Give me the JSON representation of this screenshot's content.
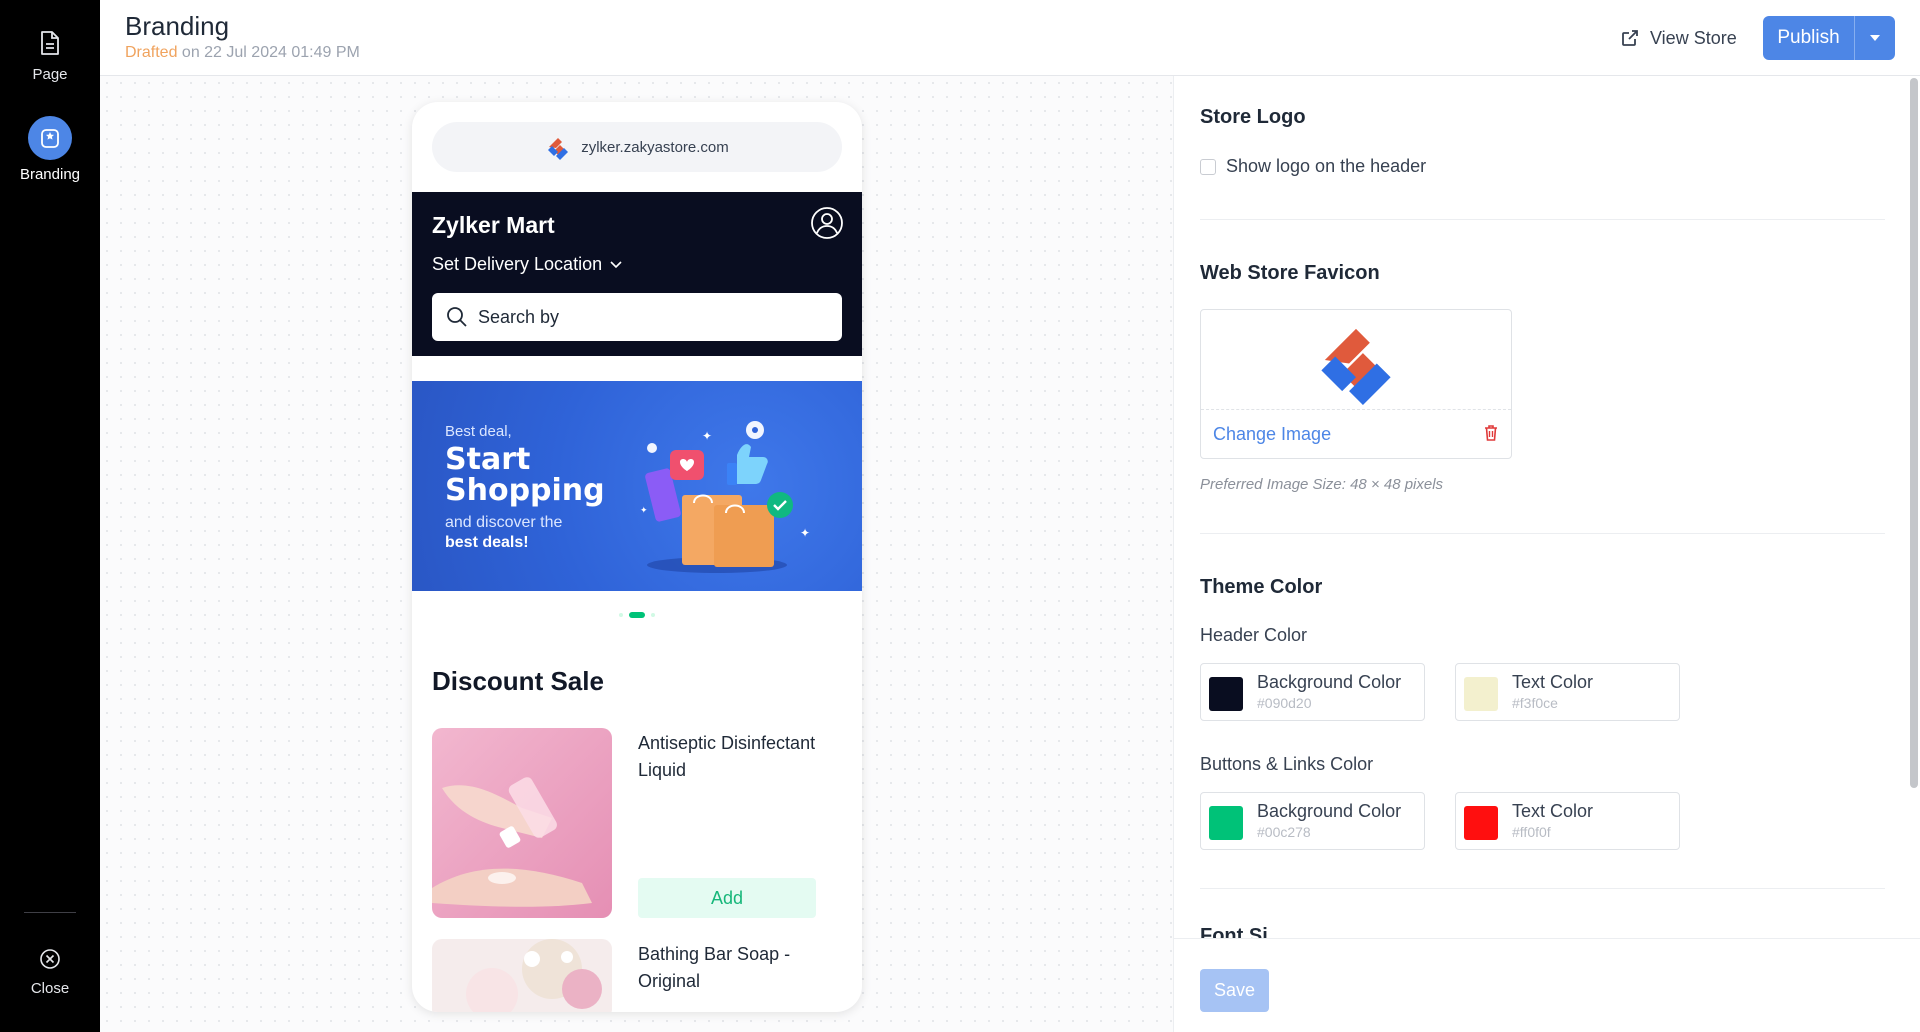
{
  "rail": {
    "page_label": "Page",
    "branding_label": "Branding",
    "close_label": "Close"
  },
  "header": {
    "title": "Branding",
    "drafted_word": "Drafted",
    "drafted_rest": " on 22 Jul 2024 01:49 PM",
    "view_store": "View Store",
    "publish": "Publish"
  },
  "preview": {
    "url": "zylker.zakyastore.com",
    "store_name": "Zylker Mart",
    "delivery": "Set Delivery Location",
    "search_placeholder": "Search by",
    "banner": {
      "line1": "Best deal,",
      "line2": "Start",
      "line3": "Shopping",
      "line4": "and discover the",
      "line5": "best deals!"
    },
    "section_title": "Discount Sale",
    "products": [
      {
        "name": "Antiseptic Disinfectant Liquid",
        "button": "Add"
      },
      {
        "name": "Bathing Bar Soap - Original"
      }
    ]
  },
  "panel": {
    "store_logo": {
      "title": "Store Logo",
      "checkbox_label": "Show logo on the header",
      "checked": false
    },
    "favicon": {
      "title": "Web Store Favicon",
      "change_label": "Change Image",
      "hint": "Preferred Image Size: 48 × 48 pixels"
    },
    "theme": {
      "title": "Theme Color",
      "header_color_label": "Header Color",
      "header_bg_label": "Background Color",
      "header_bg_value": "#090d20",
      "header_text_label": "Text Color",
      "header_text_value": "#f3f0ce",
      "buttons_label": "Buttons & Links Color",
      "buttons_bg_label": "Background Color",
      "buttons_bg_value": "#00c278",
      "buttons_text_label": "Text Color",
      "buttons_text_value": "#ff0f0f"
    },
    "next_section_partial": "Font Si...",
    "save": "Save"
  },
  "colors": {
    "accent": "#4d86e6",
    "header_bg": "#090d20",
    "header_text": "#f3f0ce",
    "button_bg": "#00c278",
    "button_text": "#ff0f0f",
    "drafted": "#f0a35e"
  }
}
